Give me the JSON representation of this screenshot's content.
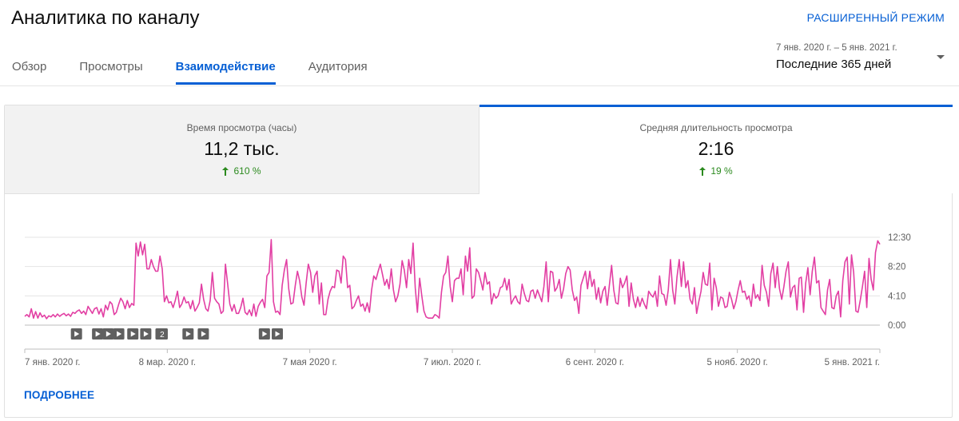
{
  "header": {
    "title": "Аналитика по каналу",
    "advanced_mode": "РАСШИРЕННЫЙ РЕЖИМ"
  },
  "tabs": [
    {
      "label": "Обзор",
      "active": false
    },
    {
      "label": "Просмотры",
      "active": false
    },
    {
      "label": "Взаимодействие",
      "active": true
    },
    {
      "label": "Аудитория",
      "active": false
    }
  ],
  "date_picker": {
    "range": "7 янв. 2020 г. – 5 янв. 2021 г.",
    "label": "Последние 365 дней",
    "icon": "dropdown-arrow-icon"
  },
  "metrics": [
    {
      "label": "Время просмотра (часы)",
      "value": "11,2 тыс.",
      "change": "610 %",
      "change_icon": "arrow-up-icon",
      "selected": false
    },
    {
      "label": "Средняя длительность просмотра",
      "value": "2:16",
      "change": "19 %",
      "change_icon": "arrow-up-icon",
      "selected": true
    }
  ],
  "colors": {
    "accent": "#065fd4",
    "series": "#e23fa3",
    "positive": "#2b8a1e"
  },
  "chart_data": {
    "type": "line",
    "x_start": "7 янв. 2020 г.",
    "x_end": "5 янв. 2021 г.",
    "x_tick_labels": [
      "7 янв. 2020 г.",
      "8 мар. 2020 г.",
      "7 мая 2020 г.",
      "7 июл. 2020 г.",
      "6 сент. 2020 г.",
      "5 нояб. 2020 г.",
      "5 янв. 2021 г."
    ],
    "y_tick_labels": [
      "12:30",
      "8:20",
      "4:10",
      "0:00"
    ],
    "y_unit": "minutes",
    "ylim": [
      0,
      750
    ],
    "grid": true,
    "series": [
      {
        "values": [
          75,
          90,
          70,
          140,
          60,
          115,
          60,
          105,
          70,
          85,
          55,
          80,
          70,
          90,
          70,
          95,
          75,
          90,
          100,
          80,
          95,
          75,
          110,
          100,
          120,
          130,
          100,
          120,
          90,
          160,
          130,
          100,
          140,
          150,
          95,
          140,
          70,
          170,
          130,
          200,
          180,
          90,
          110,
          175,
          230,
          200,
          140,
          210,
          150,
          185,
          170,
          700,
          590,
          710,
          600,
          690,
          480,
          480,
          560,
          500,
          460,
          460,
          590,
          480,
          200,
          250,
          190,
          200,
          150,
          210,
          290,
          150,
          180,
          240,
          190,
          200,
          140,
          210,
          120,
          150,
          190,
          350,
          220,
          140,
          120,
          210,
          450,
          230,
          200,
          180,
          100,
          120,
          520,
          350,
          180,
          120,
          175,
          100,
          100,
          150,
          230,
          110,
          90,
          130,
          80,
          180,
          75,
          160,
          195,
          220,
          150,
          420,
          450,
          730,
          200,
          110,
          120,
          90,
          340,
          470,
          560,
          310,
          180,
          190,
          340,
          460,
          380,
          240,
          170,
          360,
          520,
          450,
          280,
          420,
          460,
          180,
          360,
          90,
          90,
          220,
          290,
          330,
          320,
          470,
          460,
          360,
          590,
          560,
          320,
          340,
          140,
          160,
          210,
          250,
          160,
          180,
          120,
          190,
          110,
          300,
          420,
          390,
          460,
          520,
          430,
          340,
          390,
          310,
          480,
          300,
          200,
          250,
          350,
          550,
          470,
          320,
          560,
          440,
          700,
          320,
          110,
          400,
          250,
          120,
          70,
          60,
          60,
          60,
          90,
          80,
          60,
          280,
          420,
          450,
          590,
          330,
          200,
          380,
          400,
          400,
          480,
          260,
          590,
          460,
          660,
          230,
          250,
          480,
          450,
          380,
          300,
          450,
          350,
          370,
          180,
          270,
          230,
          250,
          320,
          330,
          400,
          300,
          390,
          180,
          220,
          250,
          200,
          180,
          350,
          270,
          210,
          200,
          290,
          300,
          230,
          300,
          250,
          200,
          330,
          540,
          200,
          460,
          450,
          290,
          320,
          390,
          230,
          310,
          440,
          500,
          470,
          300,
          210,
          240,
          100,
          340,
          400,
          460,
          310,
          460,
          330,
          390,
          220,
          320,
          190,
          290,
          330,
          170,
          340,
          510,
          300,
          190,
          180,
          400,
          320,
          360,
          420,
          160,
          360,
          220,
          150,
          240,
          160,
          230,
          180,
          140,
          290,
          260,
          240,
          290,
          160,
          420,
          270,
          260,
          170,
          300,
          560,
          300,
          180,
          410,
          560,
          330,
          540,
          320,
          380,
          220,
          180,
          320,
          100,
          200,
          290,
          450,
          350,
          340,
          530,
          130,
          400,
          320,
          160,
          240,
          230,
          150,
          160,
          280,
          220,
          140,
          200,
          300,
          380,
          280,
          290,
          220,
          250,
          160,
          350,
          230,
          260,
          210,
          510,
          340,
          280,
          160,
          440,
          530,
          320,
          500,
          310,
          220,
          330,
          460,
          540,
          240,
          320,
          340,
          130,
          400,
          410,
          110,
          360,
          490,
          260,
          460,
          580,
          360,
          380,
          150,
          120,
          90,
          300,
          390,
          150,
          140,
          250,
          290,
          70,
          380,
          540,
          580,
          180,
          600,
          450,
          120,
          110,
          210,
          330,
          460,
          150,
          570,
          390,
          300,
          620,
          720,
          690
        ]
      }
    ],
    "markers": [
      {
        "label": ""
      },
      {
        "label": ""
      },
      {
        "label": ""
      },
      {
        "label": ""
      },
      {
        "label": ""
      },
      {
        "label": ""
      },
      {
        "label": ""
      },
      {
        "label": "2"
      },
      {
        "label": ""
      },
      {
        "label": ""
      },
      {
        "label": ""
      },
      {
        "label": ""
      }
    ],
    "marker_positions": [
      22,
      31,
      35.5,
      40,
      46,
      51.5,
      58,
      58.5,
      69.5,
      76,
      102,
      107.5
    ]
  },
  "footer": {
    "more_link": "ПОДРОБНЕЕ"
  }
}
